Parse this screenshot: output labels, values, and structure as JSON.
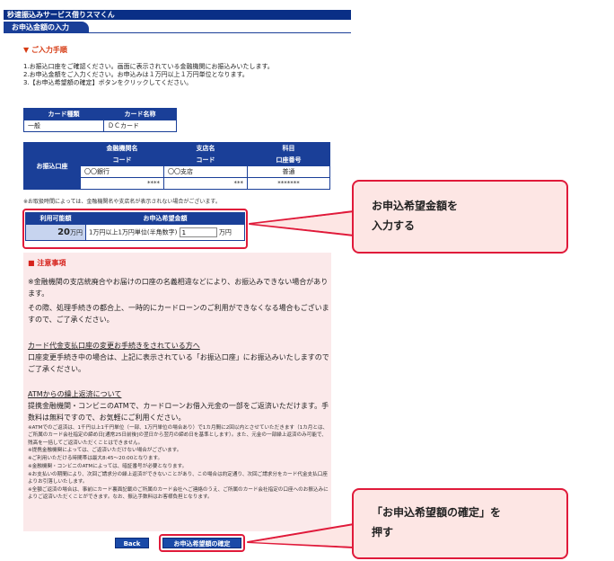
{
  "header": {
    "service_title": "秒速振込みサービス借りスマくん",
    "page_tab": "お申込金額の入力"
  },
  "instructions": {
    "heading": "▼ ご入力手順",
    "steps": [
      "1.お振込口座をご確認ください。画面に表示されている金融機関にお振込みいたします。",
      "2.お申込金額をご入力ください。お申込みは１万円以上１万円単位となります。",
      "3.【お申込希望額の確定】ボタンをクリックしてください。"
    ]
  },
  "card_table": {
    "headers": [
      "カード種類",
      "カード名称"
    ],
    "row": [
      "一般",
      "ＤＣカード"
    ]
  },
  "bank_table": {
    "row_label": "お振込口座",
    "headers_top": [
      "金融機関名",
      "支店名",
      "科目"
    ],
    "headers_sub": [
      "コード",
      "コード",
      "口座番号"
    ],
    "names": [
      "〇〇銀行",
      "〇〇支店",
      "普通"
    ],
    "codes": [
      "****",
      "***",
      "*******"
    ],
    "footnote": "※お取扱時間によっては、金融機関名や支店名が表示されない場合がございます。"
  },
  "application": {
    "header_available": "利用可能額",
    "header_amount": "お申込希望金額",
    "available_value": "20",
    "available_unit": "万円",
    "amount_hint": "1万円以上1万円単位(半角数字)",
    "amount_value": "1",
    "amount_unit": "万円"
  },
  "caution": {
    "title": "■ 注意事項",
    "p1": "※金融機関の支店統廃合やお届けの口座の名義相違などにより、お振込みできない場合があります。",
    "p2": "その際、処理手続きの都合上、一時的にカードローンのご利用ができなくなる場合もございますので、ご了承ください。",
    "p3_title": "カード代金支払口座の変更お手続きをされている方へ",
    "p3": "口座変更手続き中の場合は、上記に表示されている「お振込口座」にお振込みいたしますのでご了承ください。",
    "p4_title": "ATMからの繰上返済について",
    "p4": "提携金融機関・コンビニのATMで、カードローンお借入元金の一部をご返済いただけます。手数料は無料ですので、お気軽にご利用ください。",
    "small1": "※ATMでのご返済は、1千円以上1千円単位（一部、1万円単位の場合あり）で1カ月間に2回以内とさせていただきます（1カ月とは、ご所属のカード会社指定の締め日[通常25日前後]の翌日から翌月の締め日を基準とします）。また、元金の一部繰上返済のみ可能で、残高を一括してご返済いただくことはできません。",
    "small2": "※提携金融機関によっては、ご返済いただけない場合がございます。",
    "small3": "※ご利用いただける時間帯は最大8:45〜20:00となります。",
    "small4": "※金融機関・コンビニのATMによっては、暗証番号が必要となります。",
    "small5": "※お支払いの期間により、次回ご請求分の繰上返済ができないことがあり、この場合は約定通り、次回ご請求分をカード代金支払口座よりお引落しいたします。",
    "small6": "※全額ご返済の場合は、事前にカード裏面記載のご所属のカード会社へご連絡のうえ、ご所属のカード会社指定の口座へのお振込みによりご返済いただくことができます。なお、振込手数料はお客様負担となります。"
  },
  "buttons": {
    "back": "Back",
    "confirm": "お申込希望額の確定"
  },
  "callouts": {
    "amount_line1": "お申込希望金額を",
    "amount_line2": "入力する",
    "confirm_line1": "「お申込希望額の確定」を",
    "confirm_line2": "押す"
  },
  "colors": {
    "navy": "#1a3f98",
    "highlight_red": "#e01a3a",
    "callout_bg": "#fde6e4",
    "caution_bg": "#fbe9ea"
  }
}
